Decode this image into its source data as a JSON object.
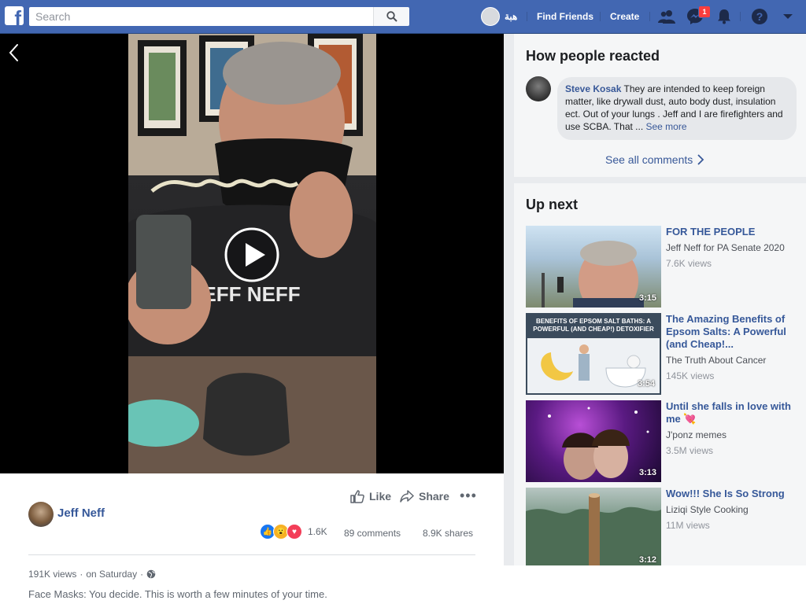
{
  "topbar": {
    "search_placeholder": "Search",
    "profile_name": "هبة",
    "find_friends": "Find Friends",
    "create": "Create",
    "messenger_badge": "1"
  },
  "post": {
    "author": "Jeff Neff",
    "like_label": "Like",
    "share_label": "Share",
    "reaction_count": "1.6K",
    "comments": "89 comments",
    "shares": "8.9K shares",
    "views": "191K views",
    "time": "on Saturday",
    "caption": "Face Masks: You decide. This is worth a few minutes of your time."
  },
  "reactions_panel": {
    "title": "How people reacted",
    "comment_author": "Steve Kosak",
    "comment_text": " They are intended to keep foreign matter, like drywall dust, auto body dust, insulation ect. Out of your lungs . Jeff and I are firefighters and use SCBA. That ... ",
    "see_more": "See more",
    "see_all": "See all comments"
  },
  "up_next": {
    "title": "Up next",
    "videos": [
      {
        "title": "FOR THE PEOPLE",
        "channel": "Jeff Neff for PA Senate 2020",
        "views": "7.6K views",
        "duration": "3:15"
      },
      {
        "title": "The Amazing Benefits of Epsom Salts: A Powerful (and Cheap!...",
        "channel": "The Truth About Cancer",
        "views": "145K views",
        "duration": "3:54"
      },
      {
        "title": "Until she falls in love with me 💘",
        "channel": "J'ponz memes",
        "views": "3.5M views",
        "duration": "3:13"
      },
      {
        "title": "Wow!!! She Is So Strong",
        "channel": "Liziqi Style Cooking",
        "views": "11M views",
        "duration": "3:12"
      }
    ],
    "thumb2_heading": "BENEFITS OF EPSOM SALT BATHS: A POWERFUL (AND CHEAP!) DETOXIFIER"
  },
  "colors": {
    "brand_blue": "#4267b2",
    "link_blue": "#365899",
    "badge_red": "#fa3e3e"
  }
}
